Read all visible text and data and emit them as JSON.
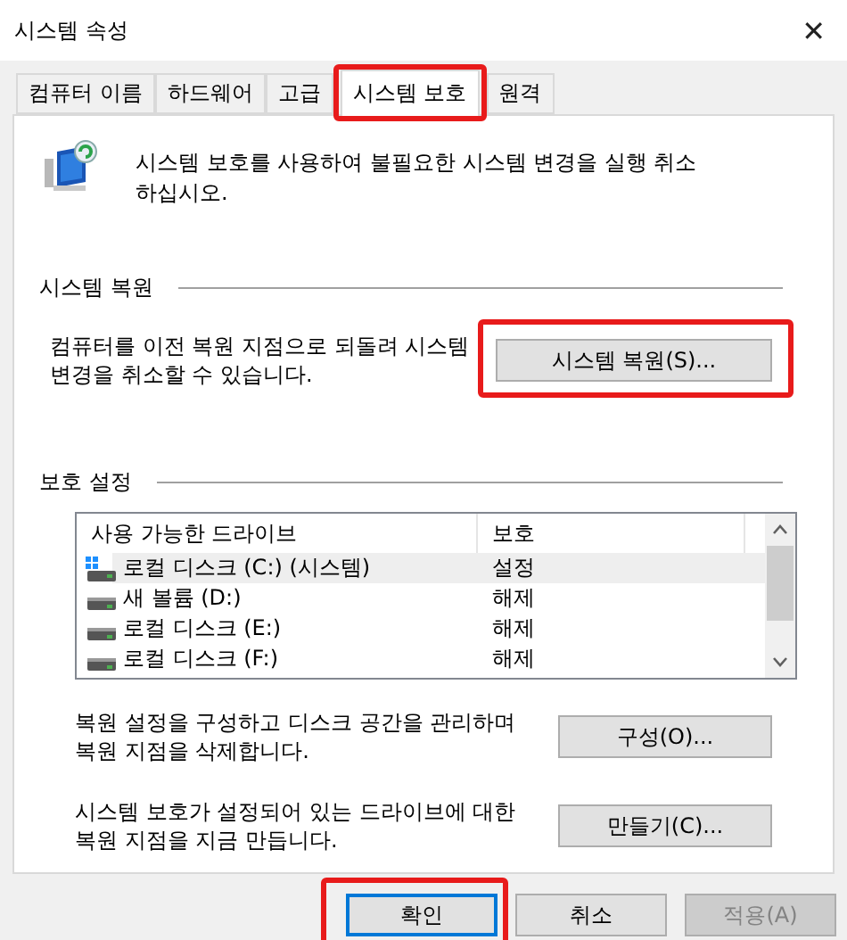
{
  "window": {
    "title": "시스템 속성",
    "close": "✕"
  },
  "tabs": [
    {
      "label": "컴퓨터 이름",
      "selected": false,
      "highlighted": false
    },
    {
      "label": "하드웨어",
      "selected": false,
      "highlighted": false
    },
    {
      "label": "고급",
      "selected": false,
      "highlighted": false
    },
    {
      "label": "시스템 보호",
      "selected": true,
      "highlighted": true
    },
    {
      "label": "원격",
      "selected": false,
      "highlighted": false
    }
  ],
  "intro": "시스템 보호를 사용하여 불필요한 시스템 변경을 실행 취소하십시오.",
  "restore": {
    "heading": "시스템 복원",
    "text": "컴퓨터를 이전 복원 지점으로 되돌려 시스템 변경을 취소할 수 있습니다.",
    "button": {
      "label": "시스템 복원(S)...",
      "highlighted": true
    }
  },
  "protection": {
    "heading": "보호 설정",
    "columns": [
      "사용 가능한 드라이브",
      "보호"
    ],
    "rows": [
      {
        "drive": "로컬 디스크 (C:) (시스템)",
        "protection": "설정",
        "kind": "system",
        "selected": true
      },
      {
        "drive": "새 볼륨 (D:)",
        "protection": "해제",
        "kind": "disk",
        "selected": false
      },
      {
        "drive": "로컬 디스크 (E:)",
        "protection": "해제",
        "kind": "disk",
        "selected": false
      },
      {
        "drive": "로컬 디스크 (F:)",
        "protection": "해제",
        "kind": "disk",
        "selected": false
      }
    ],
    "configure_text": "복원 설정을 구성하고 디스크 공간을 관리하며 복원 지점을 삭제합니다.",
    "configure_button": "구성(O)...",
    "create_text": "시스템 보호가 설정되어 있는 드라이브에 대한 복원 지점을 지금 만듭니다.",
    "create_button": "만들기(C)..."
  },
  "buttons": [
    {
      "label": "확인",
      "default": true,
      "disabled": false,
      "highlighted": true
    },
    {
      "label": "취소",
      "default": false,
      "disabled": false,
      "highlighted": false
    },
    {
      "label": "적용(A)",
      "default": false,
      "disabled": true,
      "highlighted": false
    }
  ]
}
